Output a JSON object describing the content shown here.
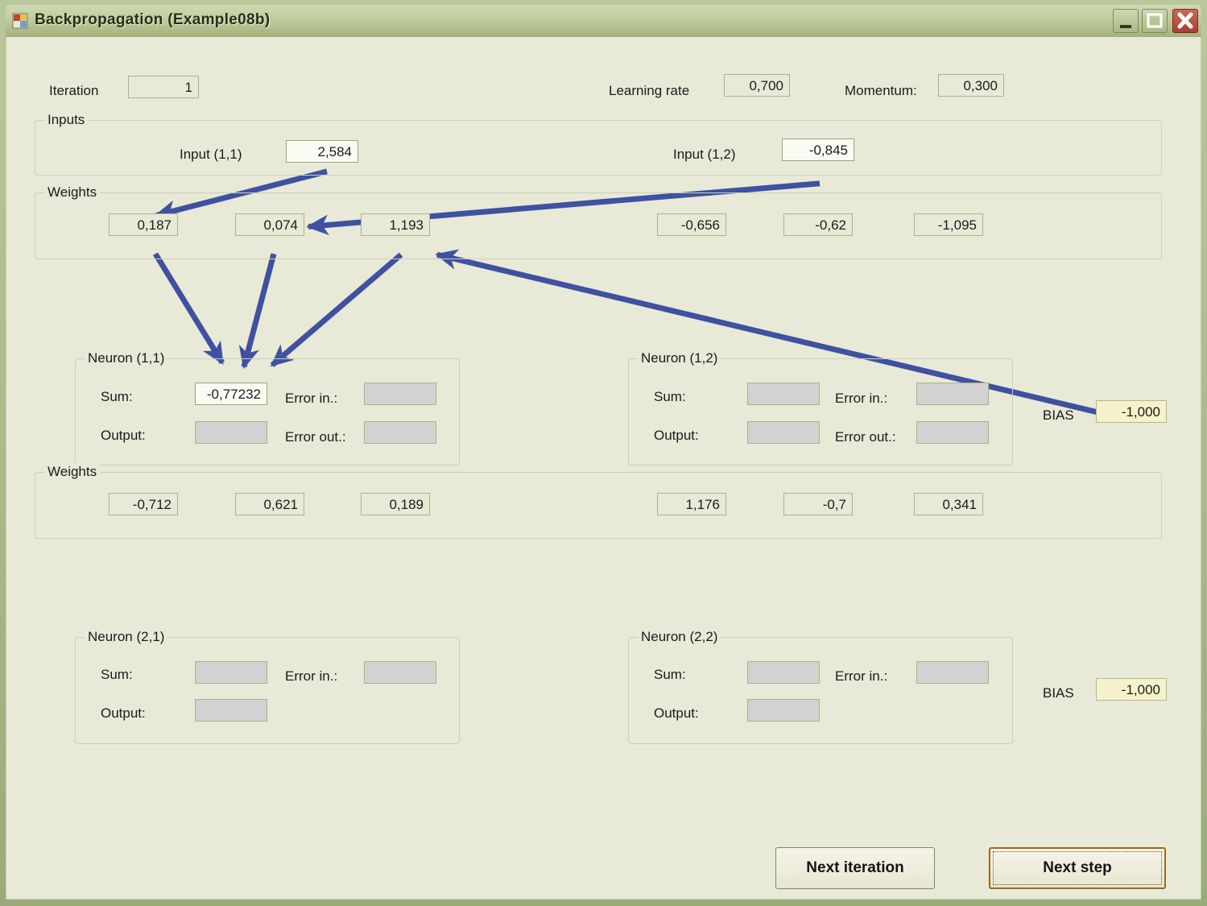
{
  "window": {
    "title": "Backpropagation (Example08b)",
    "icon": "app-window-icon",
    "minimize_label": "_",
    "maximize_label": "□",
    "close_label": "✕",
    "accent_arrow_color": "#3f51a0",
    "client_background": "#e9e9d8",
    "titlebar_color": "#aebb87"
  },
  "top": {
    "iteration_label": "Iteration",
    "iteration_value": "1",
    "learning_rate_label": "Learning rate",
    "learning_rate_value": "0,700",
    "momentum_label": "Momentum:",
    "momentum_value": "0,300"
  },
  "inputs_group": {
    "title": "Inputs",
    "items": [
      {
        "label": "Input (1,1)",
        "value": "2,584"
      },
      {
        "label": "Input (1,2)",
        "value": "-0,845"
      }
    ]
  },
  "weights_layer1": {
    "title": "Weights",
    "values": [
      "0,187",
      "0,074",
      "1,193",
      "-0,656",
      "-0,62",
      "-1,095"
    ]
  },
  "weights_layer2": {
    "title": "Weights",
    "values": [
      "-0,712",
      "0,621",
      "0,189",
      "1,176",
      "-0,7",
      "0,341"
    ]
  },
  "neuron_11": {
    "title": "Neuron (1,1)",
    "sum_label": "Sum:",
    "sum_value": "-0,77232",
    "output_label": "Output:",
    "output_value": "",
    "error_in_label": "Error in.:",
    "error_in_value": "",
    "error_out_label": "Error out.:",
    "error_out_value": ""
  },
  "neuron_12": {
    "title": "Neuron (1,2)",
    "sum_label": "Sum:",
    "sum_value": "",
    "output_label": "Output:",
    "output_value": "",
    "error_in_label": "Error in.:",
    "error_in_value": "",
    "error_out_label": "Error out.:",
    "error_out_value": ""
  },
  "neuron_21": {
    "title": "Neuron (2,1)",
    "sum_label": "Sum:",
    "sum_value": "",
    "output_label": "Output:",
    "output_value": "",
    "error_in_label": "Error in.:",
    "error_in_value": ""
  },
  "neuron_22": {
    "title": "Neuron (2,2)",
    "sum_label": "Sum:",
    "sum_value": "",
    "output_label": "Output:",
    "output_value": "",
    "error_in_label": "Error in.:",
    "error_in_value": ""
  },
  "bias_layer1": {
    "label": "BIAS",
    "value": "-1,000"
  },
  "bias_layer2": {
    "label": "BIAS",
    "value": "-1,000"
  },
  "buttons": {
    "next_iteration": "Next iteration",
    "next_step": "Next step"
  }
}
